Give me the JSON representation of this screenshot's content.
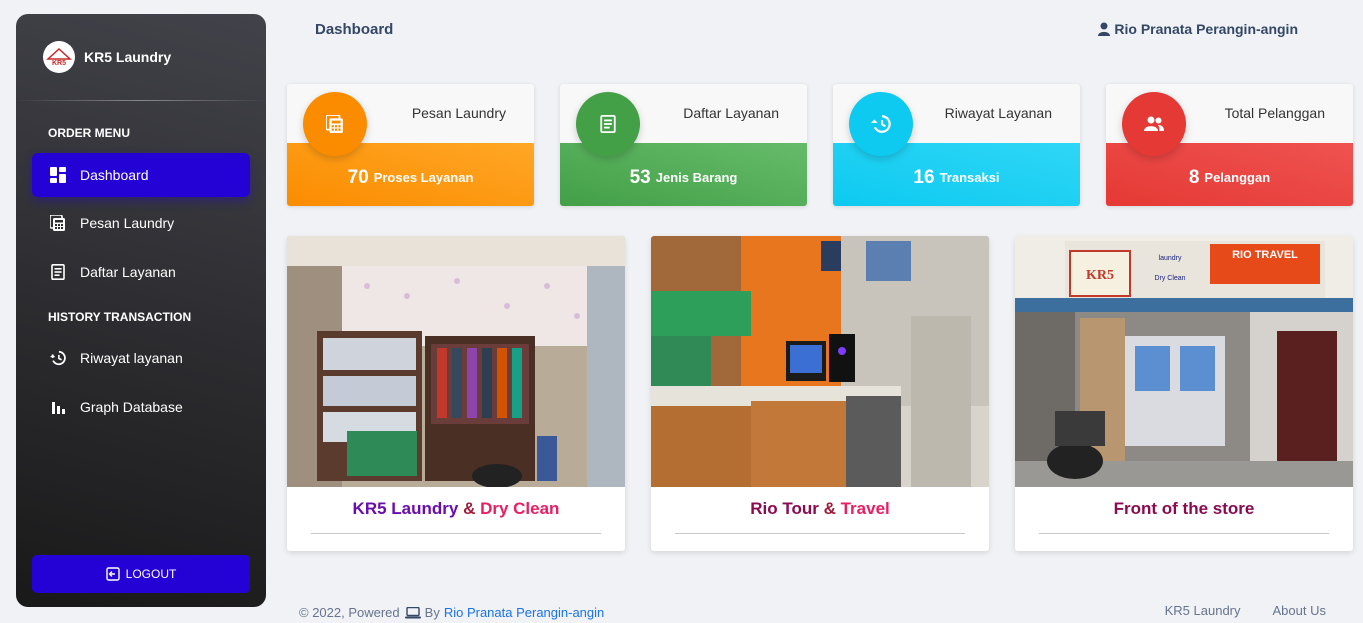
{
  "brand": {
    "name": "KR5 Laundry",
    "logo_text": "KR5"
  },
  "sidebar": {
    "section_order": "ORDER MENU",
    "section_history": "HISTORY TRANSACTION",
    "items": [
      {
        "label": "Dashboard",
        "icon": "dashboard-icon"
      },
      {
        "label": "Pesan Laundry",
        "icon": "calculator-icon"
      },
      {
        "label": "Daftar Layanan",
        "icon": "receipt-icon"
      },
      {
        "label": "Riwayat layanan",
        "icon": "history-icon"
      },
      {
        "label": "Graph Database",
        "icon": "bar-chart-icon"
      }
    ],
    "logout_label": "LOGOUT"
  },
  "header": {
    "title": "Dashboard",
    "user": "Rio Pranata Perangin-angin"
  },
  "stats": [
    {
      "label": "Pesan Laundry",
      "value": "70",
      "unit": "Proses Layanan",
      "color": "#fb8c00"
    },
    {
      "label": "Daftar Layanan",
      "value": "53",
      "unit": "Jenis Barang",
      "color": "#43a047"
    },
    {
      "label": "Riwayat Layanan",
      "value": "16",
      "unit": "Transaksi",
      "color": "#0fcaf0"
    },
    {
      "label": "Total Pelanggan",
      "value": "8",
      "unit": "Pelanggan",
      "color": "#e53935"
    }
  ],
  "photos": [
    {
      "caption_a": "KR5 Laundry",
      "caption_amp": " & ",
      "caption_b": "Dry Clean"
    },
    {
      "caption_a": "Rio Tour",
      "caption_amp": " & ",
      "caption_b": "Travel"
    },
    {
      "caption_a": "Front of the store",
      "caption_amp": "",
      "caption_b": ""
    }
  ],
  "photo_sign": {
    "title": "RIO TRAVEL",
    "line1": "laundry",
    "line2": "Dry Clean"
  },
  "footer": {
    "copyright": "© 2022, Powered",
    "by": "By",
    "author": "Rio Pranata Perangin-angin",
    "links": [
      "KR5 Laundry",
      "About Us"
    ]
  }
}
